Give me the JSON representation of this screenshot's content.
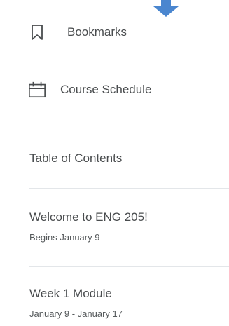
{
  "nav": {
    "bookmarks_label": "Bookmarks",
    "schedule_label": "Course Schedule"
  },
  "toc": {
    "title": "Table of Contents",
    "modules": [
      {
        "title": "Welcome to ENG 205!",
        "date": "Begins January 9"
      },
      {
        "title": "Week 1 Module",
        "date": "January 9 - January 17"
      }
    ]
  },
  "colors": {
    "accent_arrow": "#4a86cf",
    "text": "#494c4e",
    "divider": "#e3e6e9"
  },
  "icons": {
    "bookmarks": "bookmark-icon",
    "schedule": "calendar-icon",
    "arrow": "arrow-down-icon"
  }
}
